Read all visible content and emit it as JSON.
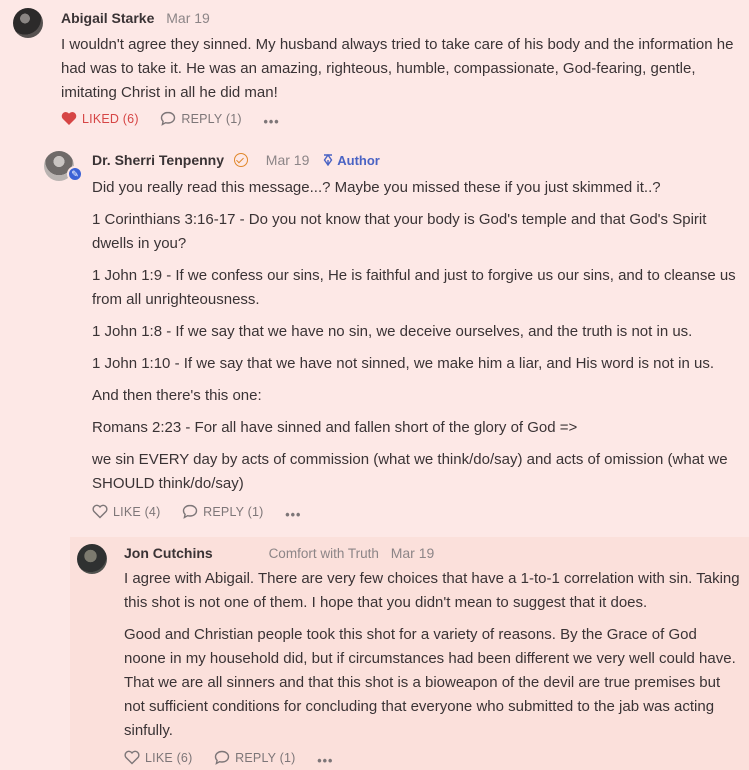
{
  "comments": [
    {
      "author": "Abigail Starke",
      "date": "Mar 19",
      "paragraphs": [
        "I wouldn't agree they sinned. My husband always tried to take care of his body and the information he had was to take it. He was an amazing, righteous, humble, compassionate, God-fearing, gentle, imitating Christ in all he did man!"
      ],
      "like_label": "LIKED (6)",
      "reply_label": "REPLY (1)",
      "more_label": "•••"
    },
    {
      "author": "Dr. Sherri Tenpenny",
      "date": "Mar 19",
      "author_tag": "Author",
      "paragraphs": [
        "Did you really read this message...? Maybe you missed these if you just skimmed it..?",
        "1 Corinthians 3:16-17 - Do you not know that your body is God's temple and that God's Spirit dwells in you?",
        "1 John 1:9 - If we confess our sins, He is faithful and just to forgive us our sins, and to cleanse us from all unrighteousness.",
        "1 John 1:8 - If we say that we have no sin, we deceive ourselves, and the truth is not in us.",
        "1 John 1:10 - If we say that we have not sinned, we make him a liar, and His word is not in us.",
        "And then there's this one:",
        "Romans 2:23 - For all have sinned and fallen short of the glory of God =>",
        "we sin EVERY day by acts of commission (what we think/do/say) and acts of omission (what we SHOULD think/do/say)"
      ],
      "like_label": "LIKE (4)",
      "reply_label": "REPLY (1)",
      "more_label": "•••"
    },
    {
      "author": "Jon Cutchins",
      "tagline": "Comfort with Truth",
      "date": "Mar 19",
      "paragraphs": [
        "I agree with Abigail. There are very few choices that have a 1-to-1 correlation with sin. Taking this shot is not one of them. I hope that you didn't mean to suggest that it does.",
        "Good and Christian people took this shot for a variety of reasons. By the Grace of God noone in my household did, but if circumstances had been different we very well could have. That we are all sinners and that this shot is a bioweapon of the devil are true premises but not sufficient conditions for concluding that everyone who submitted to the jab was acting sinfully."
      ],
      "like_label": "LIKE (6)",
      "reply_label": "REPLY (1)",
      "more_label": "•••"
    }
  ],
  "colors": {
    "background": "#fde8e6",
    "liked": "#d64545",
    "author_tag": "#4a63c4"
  }
}
